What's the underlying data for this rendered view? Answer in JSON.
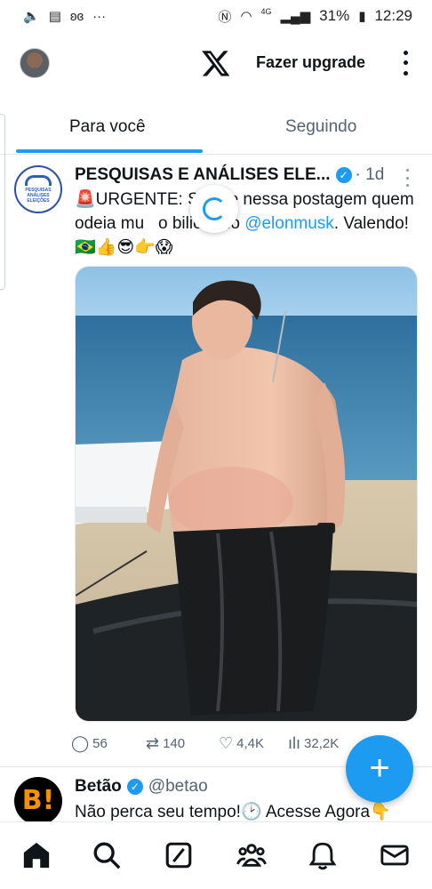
{
  "status_bar": {
    "icons_left": [
      "volume-icon",
      "gallery-icon",
      "butterfly-icon",
      "more-dots-icon"
    ],
    "network": "4G",
    "battery": "31%",
    "time": "12:29"
  },
  "appbar": {
    "upgrade_label": "Fazer upgrade"
  },
  "tabs": [
    {
      "label": "Para você",
      "active": true
    },
    {
      "label": "Seguindo",
      "active": false
    }
  ],
  "tweets": [
    {
      "name": "PESQUISAS E ANÁLISES ELE...",
      "time": "· 1d",
      "avatar_text": "PESQUISAS ANÁLISES ELEIÇÕES",
      "text_pre": "🚨URGENTE: S",
      "text_gap": "   ",
      "text_mid": "like nessa postagem quem odeia mu",
      "text_gap2": "   ",
      "text_post": "o bilionário ",
      "mention": "@elonmusk",
      "text_end": ". Valendo!🇧🇷👍😎👉😱",
      "stats": {
        "replies": "56",
        "retweets": "140",
        "likes": "4,4K",
        "views": "32,2K"
      }
    },
    {
      "name": "Betão",
      "handle": "@betao",
      "avatar_text": "B!",
      "text": "Não perca seu tempo!🕑 Acesse Agora👇"
    }
  ],
  "colors": {
    "accent": "#1d9bf0",
    "text": "#0f1419",
    "secondary": "#536471"
  },
  "bottom_nav": [
    "home-icon",
    "search-icon",
    "grok-icon",
    "communities-icon",
    "notifications-icon",
    "messages-icon"
  ]
}
